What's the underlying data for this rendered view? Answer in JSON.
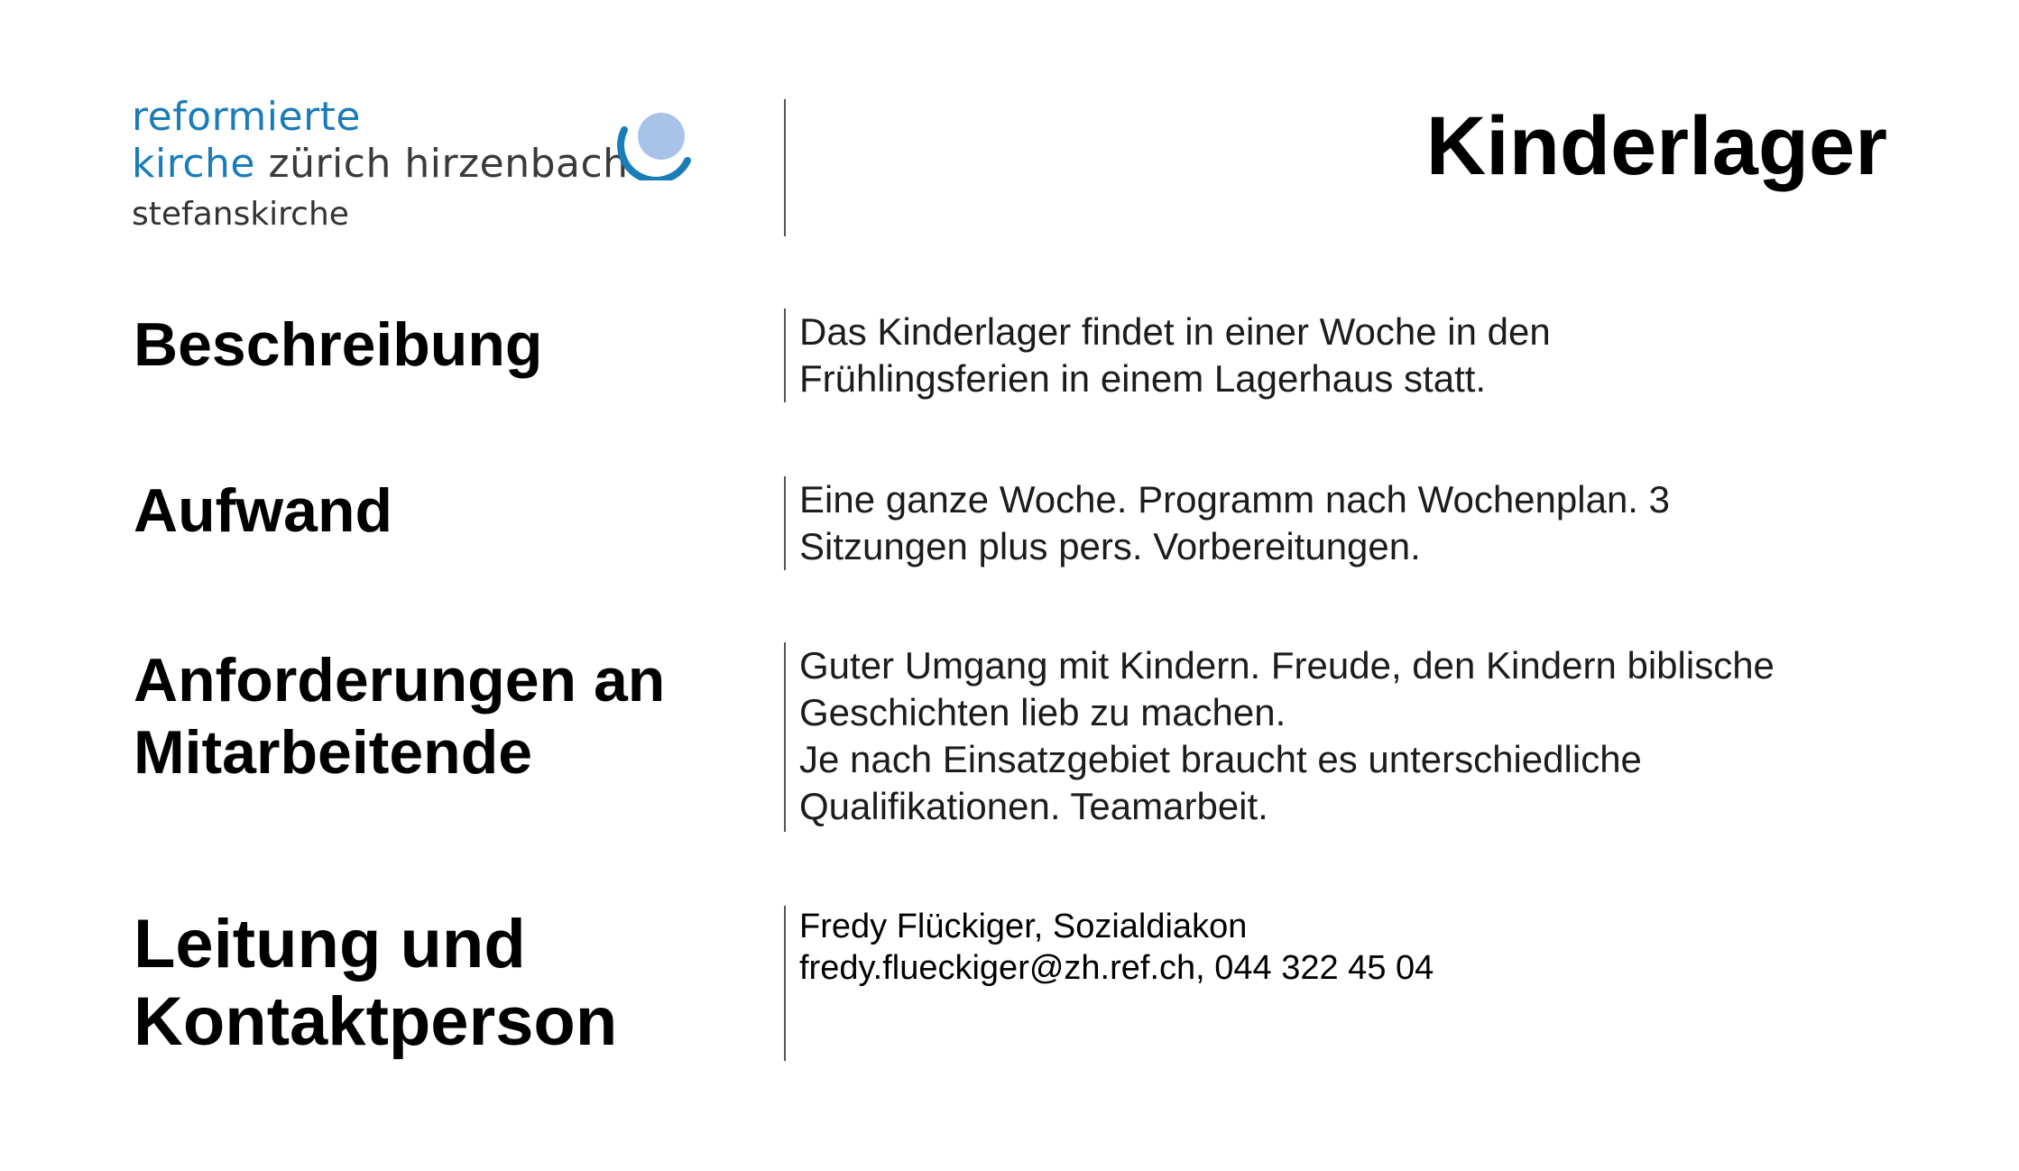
{
  "logo": {
    "line1": "reformierte",
    "line2_blue": "kirche",
    "line2_dark": " zürich hirzenbach",
    "line3": "stefanskirche",
    "mark_icon": "church-ring-logo-icon",
    "colors": {
      "blue": "#1a7cb8",
      "light_blue": "#a9c3e8"
    }
  },
  "page": {
    "title": "Kinderlager"
  },
  "rows": [
    {
      "label": "Beschreibung",
      "text": "Das Kinderlager findet in einer Woche in den\nFrühlingsferien in einem Lagerhaus statt."
    },
    {
      "label": "Aufwand",
      "text": "Eine ganze Woche. Programm nach Wochenplan. 3\nSitzungen plus pers. Vorbereitungen."
    },
    {
      "label": "Anforderungen an\nMitarbeitende",
      "text": "Guter Umgang mit Kindern. Freude, den Kindern biblische\nGeschichten lieb zu machen.\nJe nach Einsatzgebiet braucht es unterschiedliche\nQualifikationen. Teamarbeit."
    },
    {
      "label": "Leitung und\nKontaktperson",
      "text": "Fredy Flückiger, Sozialdiakon\nfredy.flueckiger@zh.ref.ch, 044 322 45 04"
    }
  ]
}
